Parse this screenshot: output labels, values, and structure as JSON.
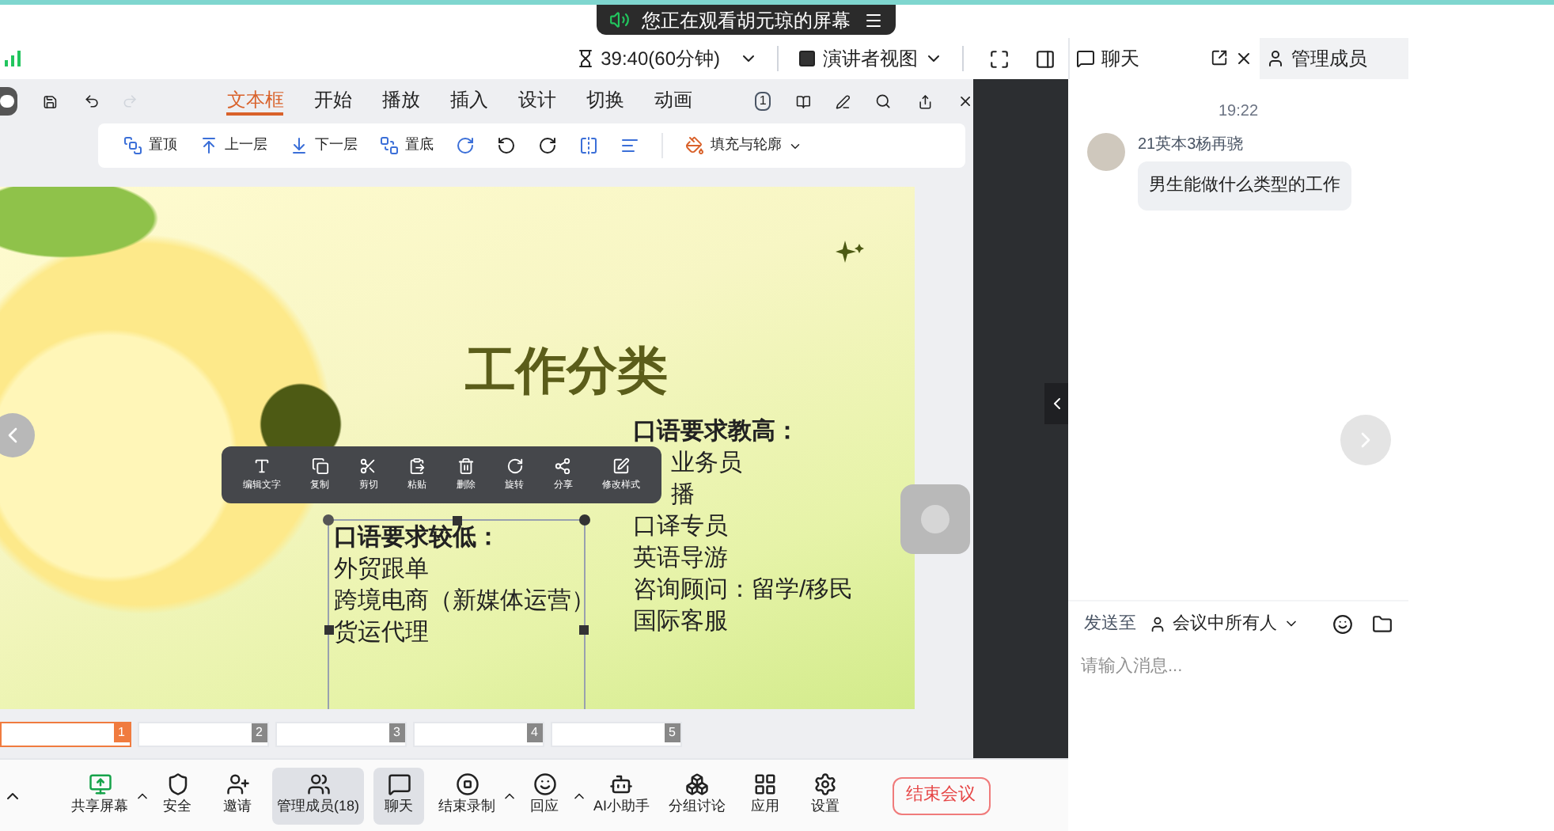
{
  "banner": {
    "text": "您正在观看胡元琼的屏幕"
  },
  "status_bar": {
    "timer": "39:40(60分钟)",
    "view": "演讲者视图"
  },
  "editor_tabs": [
    {
      "label": "文本框",
      "selected": true
    },
    {
      "label": "开始",
      "selected": false
    },
    {
      "label": "播放",
      "selected": false
    },
    {
      "label": "插入",
      "selected": false
    },
    {
      "label": "设计",
      "selected": false
    },
    {
      "label": "切换",
      "selected": false
    },
    {
      "label": "动画",
      "selected": false
    }
  ],
  "page_badge": "1",
  "ribbon": [
    "置顶",
    "上一层",
    "下一层",
    "置底"
  ],
  "fill_button": "填充与轮廓",
  "slide": {
    "title": "工作分类",
    "right_heading": "口语要求教高：",
    "right_items": [
      {
        "text": "业务员",
        "kind": "partial"
      },
      {
        "text": "播",
        "kind": "partial"
      },
      {
        "text": "口译专员",
        "kind": "full"
      },
      {
        "text": "英语导游",
        "kind": "full"
      },
      {
        "text": "咨询顾问：留学/移民",
        "kind": "full"
      },
      {
        "text": "国际客服",
        "kind": "full"
      }
    ],
    "left_heading": "口语要求较低：",
    "left_items": [
      "外贸跟单",
      "跨境电商（新媒体运营）",
      "货运代理"
    ]
  },
  "context_menu": [
    "编辑文字",
    "复制",
    "剪切",
    "粘贴",
    "删除",
    "旋转",
    "分享",
    "修改样式"
  ],
  "thumbnails": [
    {
      "number": "1",
      "selected": true
    },
    {
      "number": "2",
      "selected": false
    },
    {
      "number": "3",
      "selected": false
    },
    {
      "number": "4",
      "selected": false
    },
    {
      "number": "5",
      "selected": false
    }
  ],
  "toolbar": [
    {
      "label": "共享屏幕",
      "selected": false,
      "caret": true
    },
    {
      "label": "安全",
      "selected": false,
      "caret": false
    },
    {
      "label": "邀请",
      "selected": false,
      "caret": false
    },
    {
      "label": "管理成员(18)",
      "selected": true,
      "caret": false
    },
    {
      "label": "聊天",
      "selected": true,
      "caret": false
    },
    {
      "label": "结束录制",
      "selected": false,
      "caret": true
    },
    {
      "label": "回应",
      "selected": false,
      "caret": true
    },
    {
      "label": "AI小助手",
      "selected": false,
      "caret": false
    },
    {
      "label": "分组讨论",
      "selected": false,
      "caret": false
    },
    {
      "label": "应用",
      "selected": false,
      "caret": false
    },
    {
      "label": "设置",
      "selected": false,
      "caret": false
    }
  ],
  "end_button": "结束会议",
  "chat": {
    "tabs": [
      {
        "label": "聊天",
        "selected": true
      },
      {
        "label": "管理成员",
        "selected": false
      }
    ],
    "time": "19:22",
    "message": {
      "sender": "21英本3杨再骁",
      "text": "男生能做什么类型的工作"
    },
    "send_to_label": "发送至",
    "recipient": "会议中所有人",
    "placeholder": "请输入消息..."
  }
}
